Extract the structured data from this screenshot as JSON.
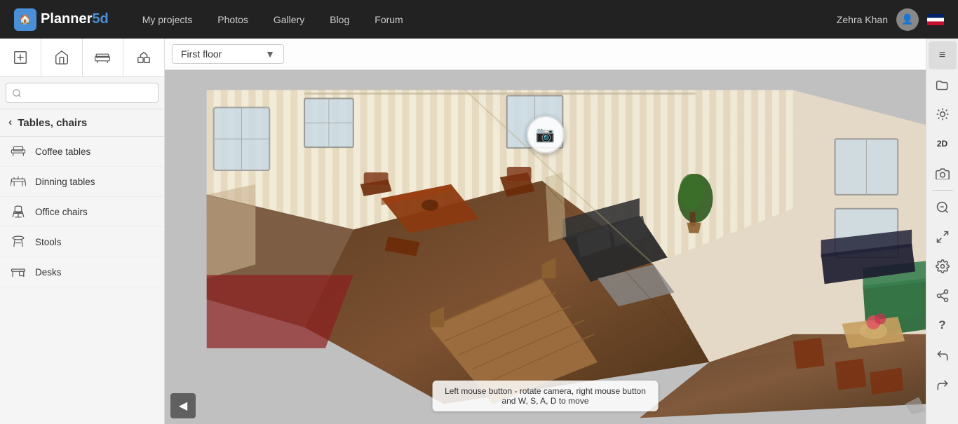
{
  "nav": {
    "logo_text": "Planner",
    "logo_suffix": "5d",
    "links": [
      "My projects",
      "Photos",
      "Gallery",
      "Blog",
      "Forum"
    ],
    "user_name": "Zehra Khan"
  },
  "floor_selector": {
    "label": "First floor",
    "arrow": "▼"
  },
  "sidebar": {
    "category": "Tables, chairs",
    "search_placeholder": "",
    "items": [
      {
        "id": "coffee-tables",
        "label": "Coffee tables",
        "icon": "table"
      },
      {
        "id": "dinning-tables",
        "label": "Dinning tables",
        "icon": "table-large"
      },
      {
        "id": "office-chairs",
        "label": "Office chairs",
        "icon": "chair"
      },
      {
        "id": "stools",
        "label": "Stools",
        "icon": "stool"
      },
      {
        "id": "desks",
        "label": "Desks",
        "icon": "desk"
      }
    ]
  },
  "tooltip": {
    "line1": "Left mouse button - rotate camera, right mouse button",
    "line2": "and W, S, A, D to move"
  },
  "right_toolbar": {
    "buttons": [
      {
        "id": "menu",
        "icon": "≡",
        "label": "menu"
      },
      {
        "id": "folder",
        "icon": "📁",
        "label": "folder"
      },
      {
        "id": "burst",
        "icon": "✳",
        "label": "burst"
      },
      {
        "id": "2d",
        "icon": "2D",
        "label": "2d-view"
      },
      {
        "id": "camera",
        "icon": "📷",
        "label": "camera"
      },
      {
        "id": "zoom-out",
        "icon": "🔍",
        "label": "zoom-out"
      },
      {
        "id": "fullscreen",
        "icon": "⤢",
        "label": "fullscreen"
      },
      {
        "id": "settings",
        "icon": "⚙",
        "label": "settings"
      },
      {
        "id": "share",
        "icon": "⎋",
        "label": "share"
      },
      {
        "id": "help",
        "icon": "?",
        "label": "help"
      },
      {
        "id": "undo",
        "icon": "↩",
        "label": "undo"
      },
      {
        "id": "redo",
        "icon": "↪",
        "label": "redo"
      }
    ]
  }
}
